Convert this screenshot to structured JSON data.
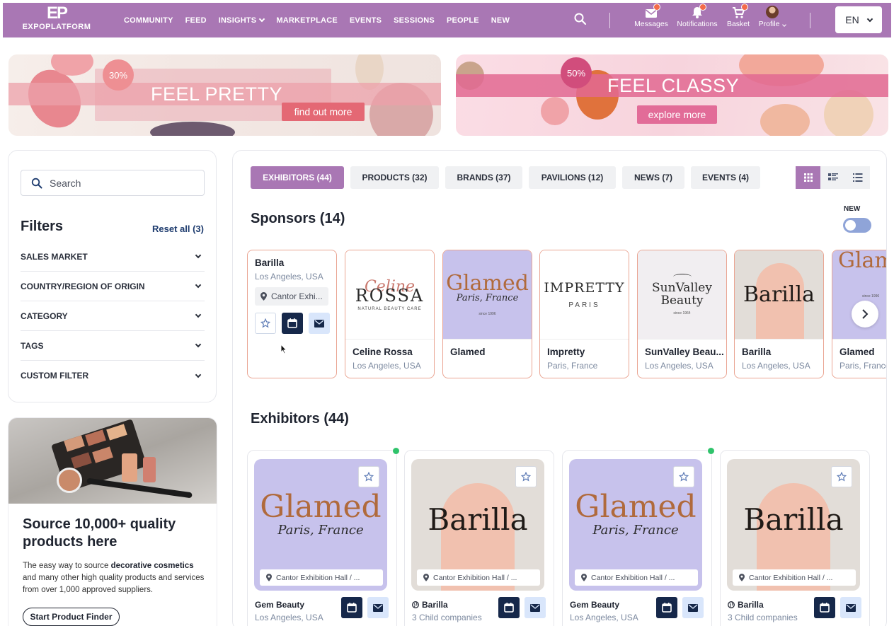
{
  "brand": {
    "logo_mark": "EP",
    "logo_word": "EXPOPLATFORM"
  },
  "nav": {
    "links": [
      "COMMUNITY",
      "FEED",
      "INSIGHTS",
      "MARKETPLACE",
      "EVENTS",
      "SESSIONS",
      "PEOPLE",
      "NEW"
    ],
    "messages": "Messages",
    "notifications": "Notifications",
    "basket": "Basket",
    "profile": "Profile",
    "language": "EN"
  },
  "banners": [
    {
      "discount": "30%",
      "title": "FEEL PRETTY",
      "cta": "find out more"
    },
    {
      "discount": "50%",
      "title": "FEEL CLASSY",
      "cta": "explore more"
    }
  ],
  "filters": {
    "search_placeholder": "Search",
    "title": "Filters",
    "reset": "Reset all (3)",
    "items": [
      "SALES MARKET",
      "COUNTRY/REGION OF ORIGIN",
      "CATEGORY",
      "TAGS",
      "CUSTOM FILTER"
    ]
  },
  "promo": {
    "heading": "Source 10,000+ quality products here",
    "body_pre": "The easy way to source ",
    "body_bold": "decorative cosmetics",
    "body_post": " and many other high quality products and services from over 1,000 approved suppliers.",
    "button": "Start Product Finder"
  },
  "tabs": [
    "EXHIBITORS (44)",
    "PRODUCTS (32)",
    "BRANDS (37)",
    "PAVILIONS (12)",
    "NEWS (7)",
    "EVENTS (4)"
  ],
  "sponsors": {
    "title": "Sponsors (14)",
    "new_label": "NEW",
    "first": {
      "name": "Barilla",
      "location": "Los Angeles, USA",
      "hall": "Cantor Exhi..."
    },
    "cards": [
      {
        "name": "Celine Rossa",
        "location": "Los Angeles, USA",
        "logo_top": "Celine",
        "logo_main": "ROSSA",
        "logo_sub": "NATURAL BEAUTY CARE"
      },
      {
        "name": "Glamed",
        "location": "",
        "logo_top": "Glamed",
        "logo_main": "Paris, France",
        "logo_sub": "since 1996"
      },
      {
        "name": "Impretty",
        "location": "Paris, France",
        "logo_top": "IMPRETTY",
        "logo_main": "PARIS",
        "logo_sub": ""
      },
      {
        "name": "SunValley Beau...",
        "location": "Los Angeles, USA",
        "logo_top": "SunValley",
        "logo_main": "Beauty",
        "logo_sub": "since 1964"
      },
      {
        "name": "Barilla",
        "location": "Los Angeles, USA",
        "logo_top": "",
        "logo_main": "Barilla",
        "logo_sub": ""
      },
      {
        "name": "Glamed",
        "location": "Paris, France",
        "logo_top": "Glam",
        "logo_main": "",
        "logo_sub": "since 1996"
      }
    ]
  },
  "exhibitors": {
    "title": "Exhibitors (44)",
    "cards": [
      {
        "name": "Gem Beauty",
        "sub": "Los Angeles, USA",
        "hall": "Cantor Exhibition Hall / ...",
        "logo": "Glamed",
        "logo_script": "Paris, France"
      },
      {
        "name": "Barilla",
        "sub": "3 Child companies",
        "hall": "Cantor Exhibition Hall / ...",
        "logo": "Barilla",
        "logo_script": ""
      },
      {
        "name": "Gem Beauty",
        "sub": "Los Angeles, USA",
        "hall": "Cantor Exhibition Hall / ...",
        "logo": "Glamed",
        "logo_script": "Paris, France"
      },
      {
        "name": "Barilla",
        "sub": "3 Child companies",
        "hall": "Cantor Exhibition Hall / ...",
        "logo": "Barilla",
        "logo_script": ""
      }
    ]
  },
  "colors": {
    "brand": "#a977b4",
    "navy": "#16284a",
    "accent_border": "#eaa593",
    "online": "#2fc36b"
  }
}
